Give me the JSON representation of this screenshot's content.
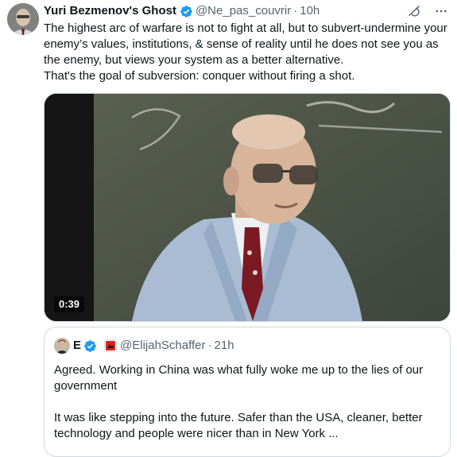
{
  "author": {
    "display_name": "Yuri Bezmenov's Ghost",
    "handle": "@Ne_pas_couvrir",
    "separator": "·",
    "timestamp": "10h"
  },
  "tweet": {
    "paragraph1": "The highest arc of warfare is not to fight at all, but to subvert-undermine your enemy’s values, institutions, & sense of reality until he does not see you as the enemy, but views your system as a better alternative.",
    "paragraph2": "That's the goal of subversion: conquer without firing a shot."
  },
  "video": {
    "duration": "0:39"
  },
  "quoted_tweet": {
    "display_name": "E",
    "handle": "@ElijahSchaffer",
    "separator": "·",
    "timestamp": "21h",
    "paragraph1": "Agreed. Working in China was what fully woke me up to the lies of our government",
    "paragraph2": "It was like stepping into the future. Safer than the USA, cleaner, better technology and people were nicer than in New York ..."
  },
  "icons": {
    "verified": "verified-badge-icon",
    "grok": "grok-icon",
    "more": "more-icon",
    "affiliate": "affiliate-badge-icon"
  },
  "colors": {
    "verified_blue": "#1d9bf0",
    "text_primary": "#0f1419",
    "text_secondary": "#536471",
    "border": "#cfd9de"
  }
}
